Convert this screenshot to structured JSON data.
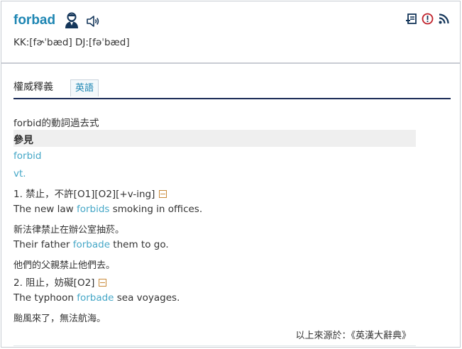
{
  "entry": {
    "word": "forbad",
    "phonetics": {
      "kk": "KK:[fɚˈbæd]",
      "dj": "DJ:[fəˈbæd]"
    }
  },
  "toolbar": {
    "icons": [
      "add-to-wordbook-icon",
      "report-error-icon",
      "rss-feed-icon"
    ]
  },
  "tabs": {
    "main": "權威釋義",
    "english": "英語"
  },
  "definition": {
    "summary": "forbid的動詞過去式",
    "see_label": "參見",
    "see_word": "forbid",
    "pos": "vt.",
    "senses": [
      {
        "title": "1. 禁止，不許[O1][O2][+v-ing]",
        "examples": [
          {
            "before": "The new law ",
            "keyword": "forbids",
            "after": " smoking in offices.",
            "translation": "新法律禁止在辦公室抽菸。"
          },
          {
            "before": "Their father ",
            "keyword": "forbade",
            "after": " them to go.",
            "translation": "他們的父親禁止他們去。"
          }
        ]
      },
      {
        "title": "2. 阻止，妨礙[O2]",
        "examples": [
          {
            "before": "The typhoon ",
            "keyword": "forbade",
            "after": " sea voyages.",
            "translation": "颱風來了，無法航海。"
          }
        ]
      }
    ],
    "source": "以上來源於：《英漢大辭典》"
  },
  "colors": {
    "word": "#1e86b3",
    "link": "#45a7c7",
    "tab_rule": "#1a2a55",
    "collapse": "#c98a3a"
  }
}
